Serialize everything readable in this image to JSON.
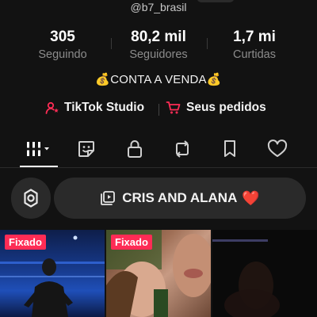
{
  "profile": {
    "handle": "@b7_brasil",
    "stats": [
      {
        "value": "305",
        "label": "Seguindo"
      },
      {
        "value": "80,2 mil",
        "label": "Seguidores"
      },
      {
        "value": "1,7 mi",
        "label": "Curtidas"
      }
    ],
    "bio": "💰CONTA A VENDA💰"
  },
  "links": {
    "studio_label": "TikTok Studio",
    "orders_label": "Seus pedidos"
  },
  "tabs": [
    {
      "icon": "grid-icon"
    },
    {
      "icon": "sticker-icon"
    },
    {
      "icon": "lock-icon"
    },
    {
      "icon": "repost-icon"
    },
    {
      "icon": "bookmark-icon"
    },
    {
      "icon": "heart-icon"
    }
  ],
  "playlist": {
    "label": "CRIS AND ALANA",
    "emoji": "❤️"
  },
  "videos": [
    {
      "badge": "Fixado"
    },
    {
      "badge": "Fixado"
    },
    {
      "badge": ""
    }
  ],
  "colors": {
    "background": "#121212",
    "accent": "#fe2c55",
    "muted_text": "#8c8c8c"
  }
}
